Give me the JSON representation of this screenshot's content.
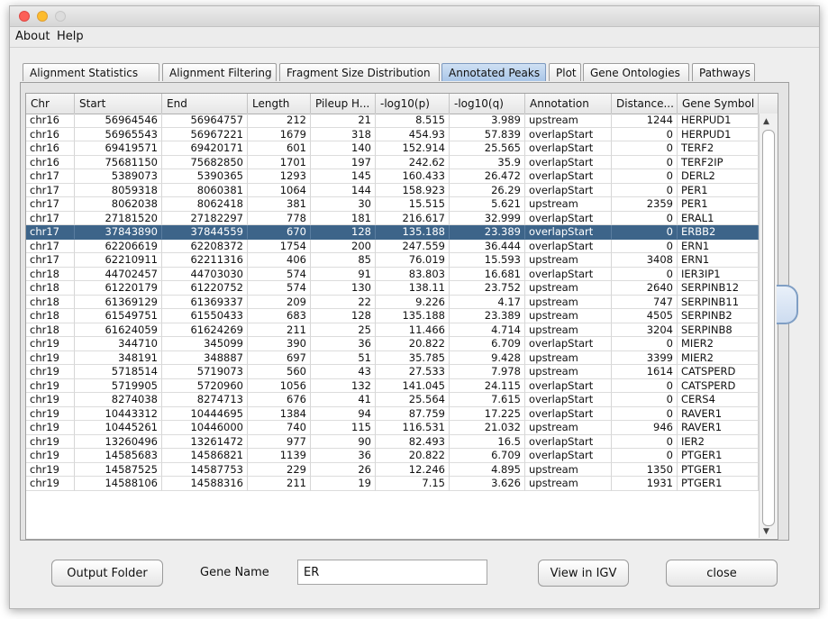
{
  "menu": {
    "about": "About",
    "help": "Help"
  },
  "tabs": [
    {
      "label": "Alignment Statistics"
    },
    {
      "label": "Alignment Filtering"
    },
    {
      "label": "Fragment Size Distribution"
    },
    {
      "label": "Annotated Peaks",
      "active": true
    },
    {
      "label": "Plot"
    },
    {
      "label": "Gene Ontologies"
    },
    {
      "label": "Pathways"
    }
  ],
  "table": {
    "columns": [
      "Chr",
      "Start",
      "End",
      "Length",
      "Pileup H...",
      "-log10(p)",
      "-log10(q)",
      "Annotation",
      "Distance...",
      "Gene Symbol"
    ],
    "selected_row": 8,
    "rows": [
      [
        "chr16",
        "56964546",
        "56964757",
        "212",
        "21",
        "8.515",
        "3.989",
        "upstream",
        "1244",
        "HERPUD1"
      ],
      [
        "chr16",
        "56965543",
        "56967221",
        "1679",
        "318",
        "454.93",
        "57.839",
        "overlapStart",
        "0",
        "HERPUD1"
      ],
      [
        "chr16",
        "69419571",
        "69420171",
        "601",
        "140",
        "152.914",
        "25.565",
        "overlapStart",
        "0",
        "TERF2"
      ],
      [
        "chr16",
        "75681150",
        "75682850",
        "1701",
        "197",
        "242.62",
        "35.9",
        "overlapStart",
        "0",
        "TERF2IP"
      ],
      [
        "chr17",
        "5389073",
        "5390365",
        "1293",
        "145",
        "160.433",
        "26.472",
        "overlapStart",
        "0",
        "DERL2"
      ],
      [
        "chr17",
        "8059318",
        "8060381",
        "1064",
        "144",
        "158.923",
        "26.29",
        "overlapStart",
        "0",
        "PER1"
      ],
      [
        "chr17",
        "8062038",
        "8062418",
        "381",
        "30",
        "15.515",
        "5.621",
        "upstream",
        "2359",
        "PER1"
      ],
      [
        "chr17",
        "27181520",
        "27182297",
        "778",
        "181",
        "216.617",
        "32.999",
        "overlapStart",
        "0",
        "ERAL1"
      ],
      [
        "chr17",
        "37843890",
        "37844559",
        "670",
        "128",
        "135.188",
        "23.389",
        "overlapStart",
        "0",
        "ERBB2"
      ],
      [
        "chr17",
        "62206619",
        "62208372",
        "1754",
        "200",
        "247.559",
        "36.444",
        "overlapStart",
        "0",
        "ERN1"
      ],
      [
        "chr17",
        "62210911",
        "62211316",
        "406",
        "85",
        "76.019",
        "15.593",
        "upstream",
        "3408",
        "ERN1"
      ],
      [
        "chr18",
        "44702457",
        "44703030",
        "574",
        "91",
        "83.803",
        "16.681",
        "overlapStart",
        "0",
        "IER3IP1"
      ],
      [
        "chr18",
        "61220179",
        "61220752",
        "574",
        "130",
        "138.11",
        "23.752",
        "upstream",
        "2640",
        "SERPINB12"
      ],
      [
        "chr18",
        "61369129",
        "61369337",
        "209",
        "22",
        "9.226",
        "4.17",
        "upstream",
        "747",
        "SERPINB11"
      ],
      [
        "chr18",
        "61549751",
        "61550433",
        "683",
        "128",
        "135.188",
        "23.389",
        "upstream",
        "4505",
        "SERPINB2"
      ],
      [
        "chr18",
        "61624059",
        "61624269",
        "211",
        "25",
        "11.466",
        "4.714",
        "upstream",
        "3204",
        "SERPINB8"
      ],
      [
        "chr19",
        "344710",
        "345099",
        "390",
        "36",
        "20.822",
        "6.709",
        "overlapStart",
        "0",
        "MIER2"
      ],
      [
        "chr19",
        "348191",
        "348887",
        "697",
        "51",
        "35.785",
        "9.428",
        "upstream",
        "3399",
        "MIER2"
      ],
      [
        "chr19",
        "5718514",
        "5719073",
        "560",
        "43",
        "27.533",
        "7.978",
        "upstream",
        "1614",
        "CATSPERD"
      ],
      [
        "chr19",
        "5719905",
        "5720960",
        "1056",
        "132",
        "141.045",
        "24.115",
        "overlapStart",
        "0",
        "CATSPERD"
      ],
      [
        "chr19",
        "8274038",
        "8274713",
        "676",
        "41",
        "25.564",
        "7.615",
        "overlapStart",
        "0",
        "CERS4"
      ],
      [
        "chr19",
        "10443312",
        "10444695",
        "1384",
        "94",
        "87.759",
        "17.225",
        "overlapStart",
        "0",
        "RAVER1"
      ],
      [
        "chr19",
        "10445261",
        "10446000",
        "740",
        "115",
        "116.531",
        "21.032",
        "upstream",
        "946",
        "RAVER1"
      ],
      [
        "chr19",
        "13260496",
        "13261472",
        "977",
        "90",
        "82.493",
        "16.5",
        "overlapStart",
        "0",
        "IER2"
      ],
      [
        "chr19",
        "14585683",
        "14586821",
        "1139",
        "36",
        "20.822",
        "6.709",
        "overlapStart",
        "0",
        "PTGER1"
      ],
      [
        "chr19",
        "14587525",
        "14587753",
        "229",
        "26",
        "12.246",
        "4.895",
        "upstream",
        "1350",
        "PTGER1"
      ],
      [
        "chr19",
        "14588106",
        "14588316",
        "211",
        "19",
        "7.15",
        "3.626",
        "upstream",
        "1931",
        "PTGER1"
      ]
    ]
  },
  "scroll_icons": {
    "up": "arrow-up-icon",
    "down": "arrow-down-icon"
  },
  "bottom": {
    "output_folder": "Output Folder",
    "gene_name_label": "Gene Name",
    "gene_name_value": "ER",
    "view_igv": "View in IGV",
    "close": "close"
  }
}
